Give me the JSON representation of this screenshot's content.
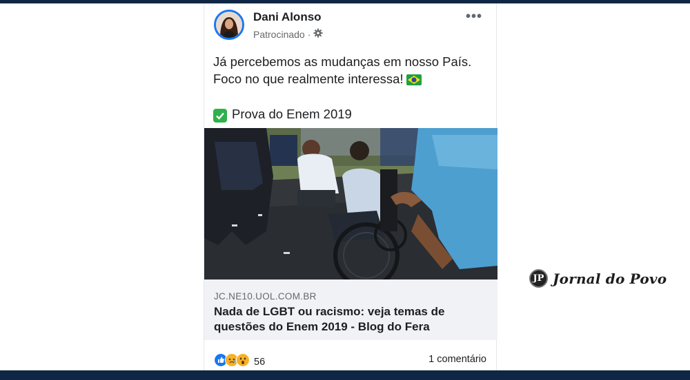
{
  "post": {
    "author": "Dani Alonso",
    "meta": "Patrocinado",
    "meta_separator": "·",
    "more_label": "•••",
    "text_line1": "Já percebemos as mudanças em nosso País.",
    "text_line2": "Foco no que realmente interessa!",
    "text_line3": "Prova do Enem 2019",
    "link": {
      "domain": "JC.NE10.UOL.COM.BR",
      "headline": "Nada de LGBT ou racismo: veja temas de questões do Enem 2019 - Blog do Fera"
    },
    "reactions": {
      "count": "56",
      "comments": "1 comentário",
      "types": [
        "like-icon",
        "sad-icon",
        "wow-icon"
      ]
    }
  },
  "watermark": {
    "badge": "JP",
    "name": "Jornal do Povo"
  },
  "colors": {
    "frame_bar": "#0f2744",
    "avatar_ring": "#1877f2",
    "link_box_bg": "#f0f2f5",
    "check_green": "#2fb14a"
  }
}
